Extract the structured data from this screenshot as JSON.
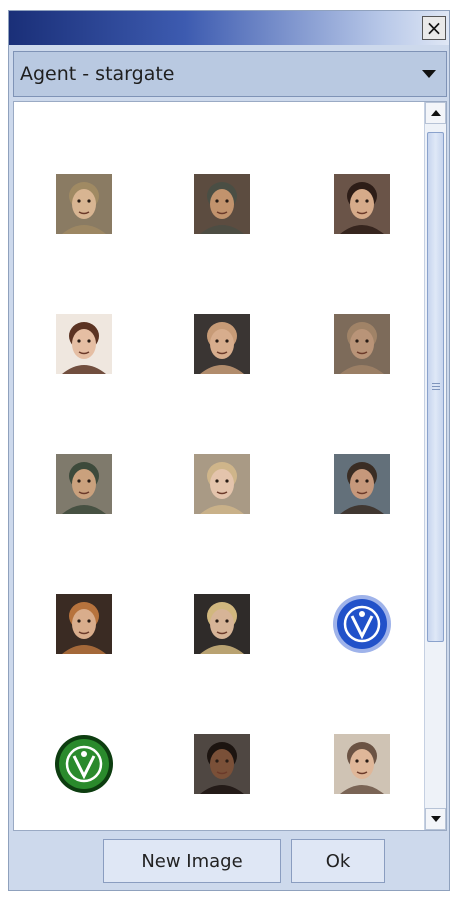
{
  "window": {
    "close_label": "×"
  },
  "combo": {
    "value": "Agent - stargate"
  },
  "grid": {
    "items": [
      {
        "name": "agent-portrait-1",
        "kind": "face",
        "bg": "#8a7b63",
        "skin": "#d8b592",
        "hair": "#a08a63"
      },
      {
        "name": "agent-portrait-2",
        "kind": "face",
        "bg": "#5c4c40",
        "skin": "#c2936d",
        "hair": "#4a4e44"
      },
      {
        "name": "agent-portrait-3",
        "kind": "face",
        "bg": "#6a5448",
        "skin": "#d6ab8a",
        "hair": "#2d1d17"
      },
      {
        "name": "agent-portrait-4",
        "kind": "face",
        "bg": "#efe7df",
        "skin": "#e5bea3",
        "hair": "#5b3322"
      },
      {
        "name": "agent-portrait-5",
        "kind": "face",
        "bg": "#3a3533",
        "skin": "#d7ad8d",
        "hair": "#c79b77"
      },
      {
        "name": "agent-portrait-6",
        "kind": "face",
        "bg": "#7d6b5a",
        "skin": "#b99478",
        "hair": "#a08367"
      },
      {
        "name": "agent-portrait-7",
        "kind": "face",
        "bg": "#7f7a6c",
        "skin": "#caa17d",
        "hair": "#3d4a3b"
      },
      {
        "name": "agent-portrait-8",
        "kind": "face",
        "bg": "#a99a85",
        "skin": "#e4c4ac",
        "hair": "#cfb58a"
      },
      {
        "name": "agent-portrait-9",
        "kind": "face",
        "bg": "#63707a",
        "skin": "#c6987b",
        "hair": "#3a2d24"
      },
      {
        "name": "agent-portrait-10",
        "kind": "face",
        "bg": "#3a2b23",
        "skin": "#d9ad8c",
        "hair": "#b7733d"
      },
      {
        "name": "agent-portrait-11",
        "kind": "face",
        "bg": "#2f2b29",
        "skin": "#d6b497",
        "hair": "#d1b77e"
      },
      {
        "name": "stargate-command-emblem-icon",
        "kind": "emblem",
        "color": "#2151c9",
        "ring": "#9fb3ea"
      },
      {
        "name": "alpha-site-emblem-icon",
        "kind": "emblem",
        "color": "#2a8a2c",
        "ring": "#0d3d10"
      },
      {
        "name": "agent-portrait-12",
        "kind": "face",
        "bg": "#4f4742",
        "skin": "#7a5038",
        "hair": "#1c1410"
      },
      {
        "name": "agent-portrait-13",
        "kind": "face",
        "bg": "#cfc3b4",
        "skin": "#dfb799",
        "hair": "#6b5344"
      }
    ]
  },
  "footer": {
    "new_image_label": "New Image",
    "ok_label": "Ok"
  }
}
